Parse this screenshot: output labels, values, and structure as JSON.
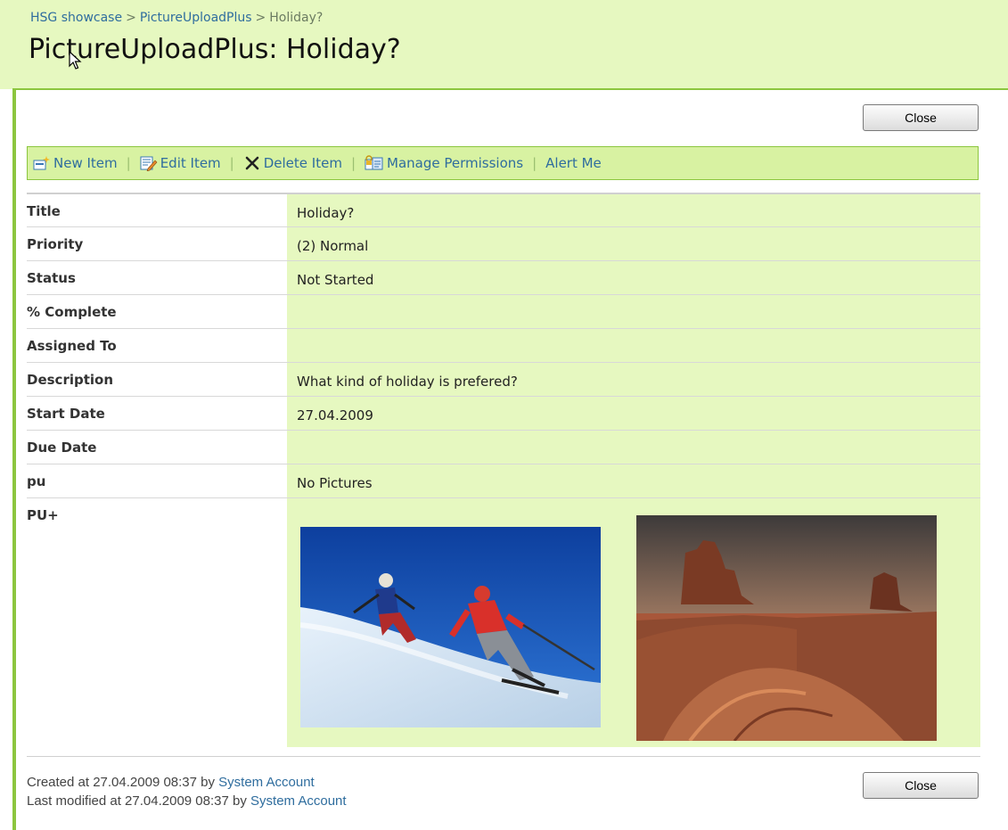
{
  "breadcrumb": {
    "root": "HSG showcase",
    "list": "PictureUploadPlus",
    "current": "Holiday?",
    "separator": ">"
  },
  "page": {
    "title": "PictureUploadPlus: Holiday?"
  },
  "buttons": {
    "close_label": "Close"
  },
  "toolbar": {
    "new_item": "New Item",
    "edit_item": "Edit Item",
    "delete_item": "Delete Item",
    "manage_permissions": "Manage Permissions",
    "alert_me": "Alert Me"
  },
  "fields": [
    {
      "label": "Title",
      "value": "Holiday?"
    },
    {
      "label": "Priority",
      "value": "(2) Normal"
    },
    {
      "label": "Status",
      "value": "Not Started"
    },
    {
      "label": "% Complete",
      "value": ""
    },
    {
      "label": "Assigned To",
      "value": ""
    },
    {
      "label": "Description",
      "value": "What kind of holiday is prefered?"
    },
    {
      "label": "Start Date",
      "value": "27.04.2009"
    },
    {
      "label": "Due Date",
      "value": ""
    },
    {
      "label": "pu",
      "value": "No Pictures"
    },
    {
      "label": "PU+",
      "value": ""
    }
  ],
  "footer": {
    "created_prefix": "Created at 27.04.2009 08:37  by ",
    "created_by": "System Account",
    "modified_prefix": "Last modified at 27.04.2009 08:37  by ",
    "modified_by": "System Account"
  },
  "colors": {
    "accent": "#8cc63f",
    "value_bg": "#e6f8c0",
    "link": "#2f6d9e"
  }
}
